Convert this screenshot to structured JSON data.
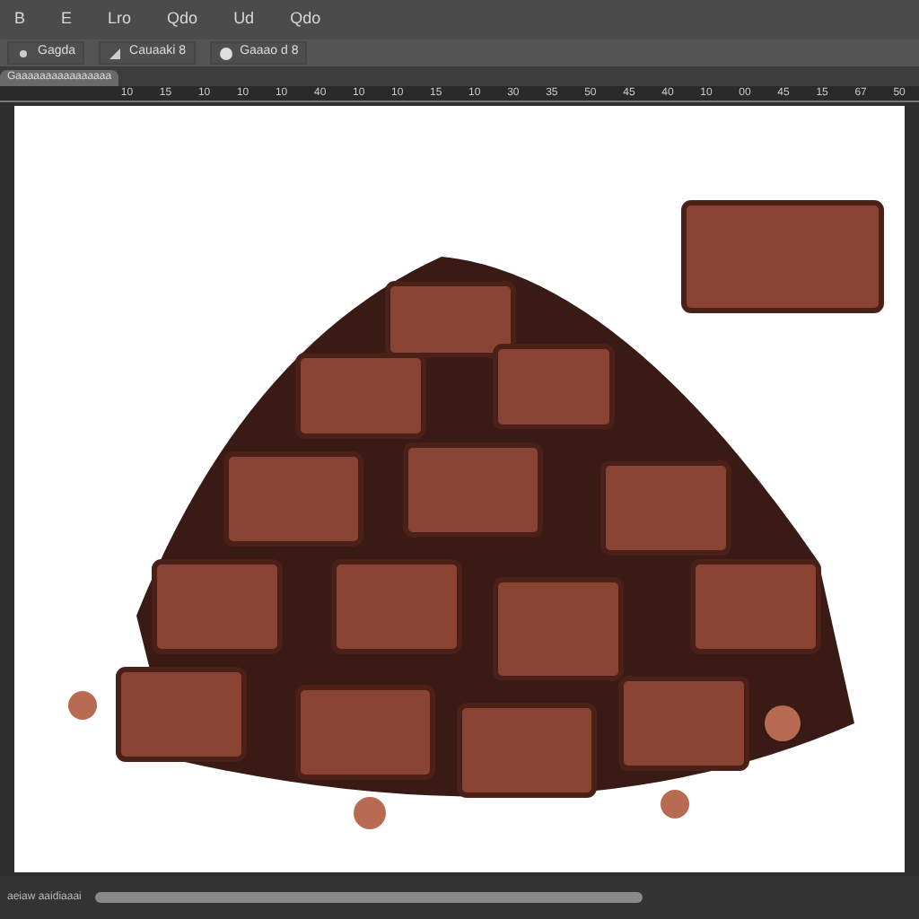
{
  "menu": [
    "B",
    "E",
    "Lro",
    "Qdo",
    "Ud",
    "Qdo"
  ],
  "options": [
    {
      "label": "Gagda"
    },
    {
      "label": "Cauaaki 8"
    },
    {
      "label": "Gaaao d 8"
    }
  ],
  "document_tab": {
    "title": "Gaaaaaaaaaaaaaaaa"
  },
  "ruler": [
    "10",
    "15",
    "10",
    "10",
    "10",
    "40",
    "10",
    "10",
    "15",
    "10",
    "30",
    "35",
    "50",
    "45",
    "40",
    "10",
    "00",
    "45",
    "15",
    "67",
    "50"
  ],
  "status_bar": {
    "text": "aeiaw aaidiaaai"
  }
}
